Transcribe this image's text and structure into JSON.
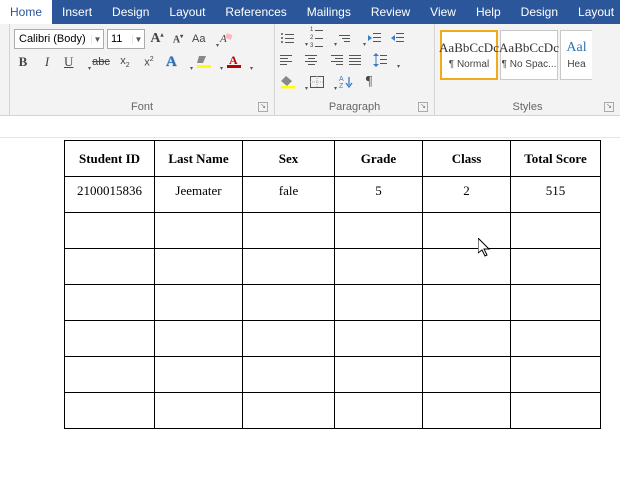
{
  "ribbonTabs": {
    "home": "Home",
    "insert": "Insert",
    "design": "Design",
    "layout": "Layout",
    "references": "References",
    "mailings": "Mailings",
    "review": "Review",
    "view": "View",
    "help": "Help",
    "ctxDesign": "Design",
    "ctxLayout": "Layout"
  },
  "font": {
    "name": "Calibri (Body)",
    "size": "11",
    "groupLabel": "Font"
  },
  "paragraph": {
    "groupLabel": "Paragraph"
  },
  "styles": {
    "groupLabel": "Styles",
    "sample": "AaBbCcDc",
    "sampleHeading": "Aal",
    "normal": "¶ Normal",
    "nospac": "¶ No Spac...",
    "heading": "Hea"
  },
  "table": {
    "headers": {
      "id": "Student ID",
      "last": "Last Name",
      "sex": "Sex",
      "grade": "Grade",
      "class": "Class",
      "score": "Total Score"
    },
    "row1": {
      "id": "2100015836",
      "last": "Jeemater",
      "sex": "fale",
      "grade": "5",
      "class": "2",
      "score": "515"
    }
  }
}
